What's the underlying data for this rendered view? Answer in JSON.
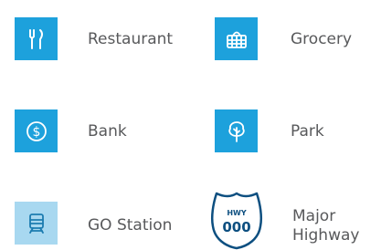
{
  "colors": {
    "tile_primary": "#1da1dc",
    "tile_light": "#a8d8f0",
    "icon_white": "#ffffff",
    "icon_dark": "#1c7cb0",
    "label_text": "#58595b",
    "shield_stroke": "#0d4f80",
    "shield_text": "#0d4f80"
  },
  "legend": {
    "restaurant": {
      "label": "Restaurant",
      "icon": "fork-knife-icon"
    },
    "grocery": {
      "label": "Grocery",
      "icon": "basket-icon"
    },
    "bank": {
      "label": "Bank",
      "icon": "dollar-coin-icon"
    },
    "park": {
      "label": "Park",
      "icon": "tree-icon"
    },
    "go_station": {
      "label": "GO Station",
      "icon": "train-icon"
    },
    "major_highway": {
      "label_line1": "Major",
      "label_line2": "Highway",
      "shield_top": "HWY",
      "shield_number": "000",
      "icon": "highway-shield-icon"
    }
  }
}
